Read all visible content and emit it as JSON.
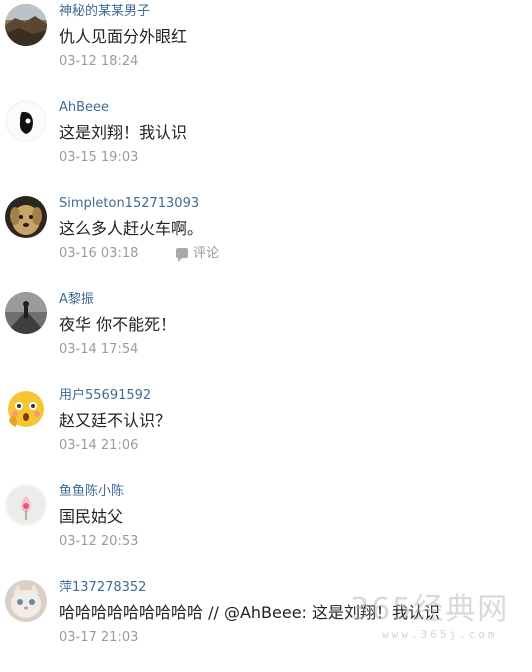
{
  "comments": [
    {
      "username": "神秘的某某男子",
      "text": "仇人见面分外眼红",
      "time": "03-12 18:24"
    },
    {
      "username": "AhBeee",
      "text": "这是刘翔！我认识",
      "time": "03-15 19:03"
    },
    {
      "username": "Simpleton152713093",
      "text": "这么多人赶火车啊。",
      "time": "03-16 03:18",
      "reply_label": "评论"
    },
    {
      "username": "A黎振",
      "text": "夜华 你不能死！",
      "time": "03-14 17:54"
    },
    {
      "username": "用户55691592",
      "text": "赵又廷不认识？",
      "time": "03-14 21:06"
    },
    {
      "username": "鱼鱼陈小陈",
      "text": "国民姑父",
      "time": "03-12 20:53"
    },
    {
      "username": "萍137278352",
      "text": "哈哈哈哈哈哈哈哈哈 // @AhBeee: 这是刘翔！我认识",
      "time": "03-17 21:03"
    }
  ],
  "watermark": {
    "main": "365经典网",
    "url": "www.365j.com"
  },
  "colors": {
    "username": "#3f6b98",
    "text": "#222222",
    "time": "#9a9a9a"
  },
  "avatars": [
    "landscape-photo",
    "black-white-cartoon",
    "puppy-photo",
    "rainy-street-photo",
    "shocked-emoji",
    "pink-flower",
    "cat-photo"
  ]
}
